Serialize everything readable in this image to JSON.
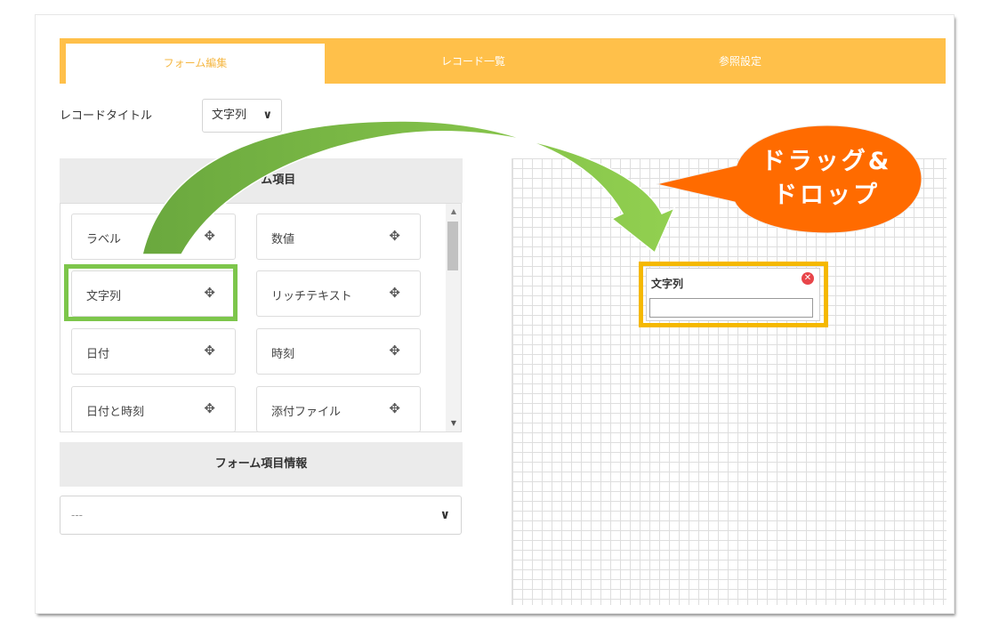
{
  "tabs": [
    {
      "label": "フォーム編集",
      "active": true
    },
    {
      "label": "レコード一覧",
      "active": false
    },
    {
      "label": "参照設定",
      "active": false
    }
  ],
  "record_title": {
    "label": "レコードタイトル",
    "value": "文字列"
  },
  "form_items": {
    "header": "フォーム項目",
    "items": [
      {
        "label": "ラベル"
      },
      {
        "label": "数値"
      },
      {
        "label": "文字列"
      },
      {
        "label": "リッチテキスト"
      },
      {
        "label": "日付"
      },
      {
        "label": "時刻"
      },
      {
        "label": "日付と時刻"
      },
      {
        "label": "添付ファイル"
      }
    ]
  },
  "form_item_info": {
    "header": "フォーム項目情報",
    "value": "---"
  },
  "canvas": {
    "dropped_field": {
      "label": "文字列",
      "value": ""
    }
  },
  "callout": {
    "line1": "ドラッグ&",
    "line2": "ドロップ"
  },
  "colors": {
    "tab_bar": "#ffc04a",
    "green_arrow": "#7dc64b",
    "callout": "#ff6b00",
    "highlight_orange": "#f5b800"
  }
}
